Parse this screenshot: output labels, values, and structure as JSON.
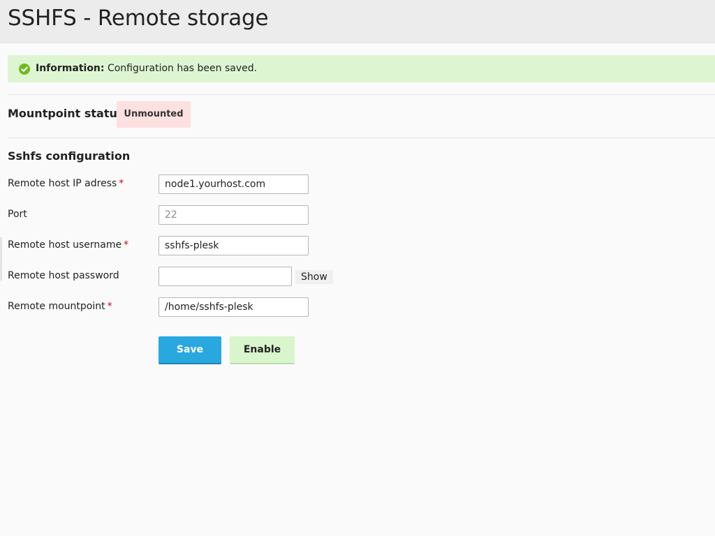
{
  "header": {
    "title": "SSHFS - Remote storage"
  },
  "message": {
    "icon": "check-circle-icon",
    "label": "Information:",
    "text": " Configuration has been saved.",
    "bg_color": "#def5d2",
    "icon_color": "#6cbb1f"
  },
  "mountpoint": {
    "label": "Mountpoint status :",
    "status": "Unmounted",
    "status_color": "#fde0e0"
  },
  "config": {
    "title": "Sshfs configuration",
    "required_marker": "*",
    "fields": {
      "host": {
        "label": "Remote host IP adress",
        "value": "node1.yourhost.com",
        "placeholder": ""
      },
      "port": {
        "label": "Port",
        "value": "",
        "placeholder": "22"
      },
      "username": {
        "label": "Remote host username",
        "value": "sshfs-plesk",
        "placeholder": ""
      },
      "password": {
        "label": "Remote host password",
        "value": "",
        "placeholder": "",
        "show_label": "Show"
      },
      "mountpoint": {
        "label": "Remote mountpoint",
        "value": "/home/sshfs-plesk",
        "placeholder": ""
      }
    }
  },
  "buttons": {
    "save": "Save",
    "enable": "Enable",
    "save_color": "#28a8df",
    "enable_color": "#d9f5cc"
  }
}
